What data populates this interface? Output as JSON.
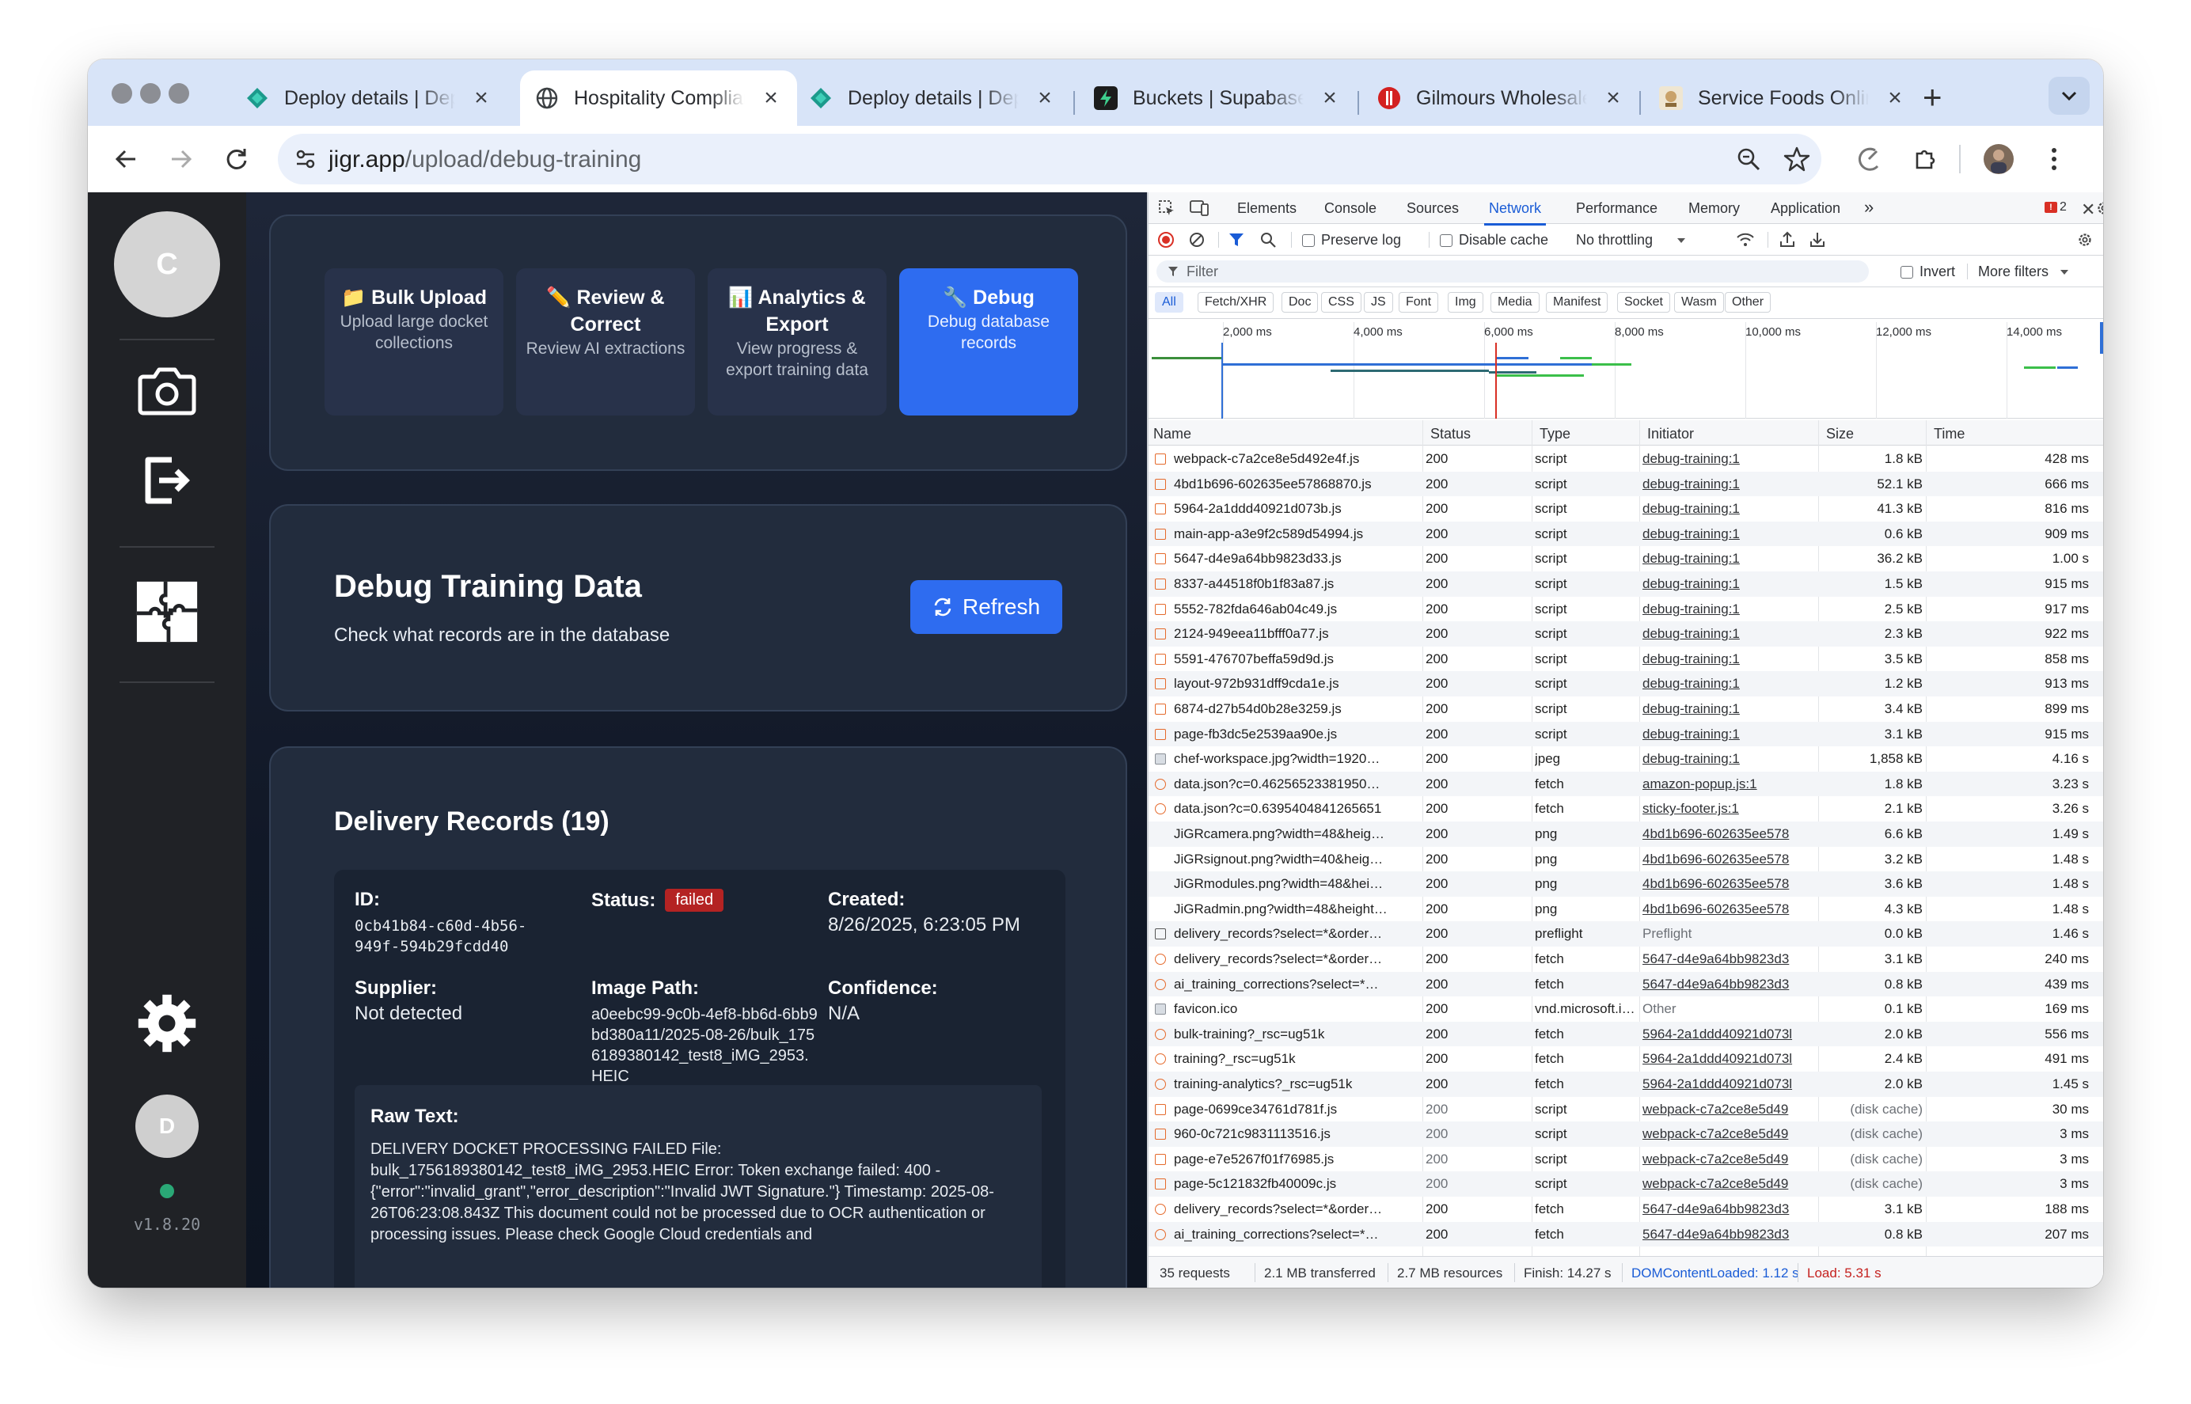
{
  "browser": {
    "tabs": [
      {
        "title": "Deploy details | Deploy",
        "favicon": "netlify-icon"
      },
      {
        "title": "Hospitality Compliance",
        "favicon": "globe-icon"
      },
      {
        "title": "Deploy details | Deploy",
        "favicon": "netlify-icon"
      },
      {
        "title": "Buckets | Supabase",
        "favicon": "supabase-icon"
      },
      {
        "title": "Gilmours Wholesale",
        "favicon": "gilmours-icon"
      },
      {
        "title": "Service Foods Online",
        "favicon": "service-foods-icon"
      }
    ],
    "url_host": "jigr.app",
    "url_path": "/upload/debug-training"
  },
  "app": {
    "sidebar": {
      "avatar_letter": "C",
      "user_letter": "D",
      "version": "v1.8.20"
    },
    "nav_tabs": [
      {
        "emoji": "📁",
        "title": "Bulk Upload",
        "desc": "Upload large docket collections"
      },
      {
        "emoji": "✏️",
        "title": "Review & Correct",
        "desc": "Review AI extractions"
      },
      {
        "emoji": "📊",
        "title": "Analytics & Export",
        "desc": "View progress & export training data"
      },
      {
        "emoji": "🔧",
        "title": "Debug",
        "desc": "Debug database records"
      }
    ],
    "debug": {
      "title": "Debug Training Data",
      "subtitle": "Check what records are in the database",
      "refresh_label": "Refresh"
    },
    "records": {
      "title": "Delivery Records (19)",
      "id_label": "ID:",
      "id_value": "0cb41b84-c60d-4b56-949f-594b29fcdd40",
      "status_label": "Status:",
      "status_value": "failed",
      "created_label": "Created:",
      "created_value": "8/26/2025, 6:23:05 PM",
      "supplier_label": "Supplier:",
      "supplier_value": "Not detected",
      "image_path_label": "Image Path:",
      "image_path_value": "a0eebc99-9c0b-4ef8-bb6d-6bb9bd380a11/2025-08-26/bulk_1756189380142_test8_iMG_2953.HEIC",
      "confidence_label": "Confidence:",
      "confidence_value": "N/A",
      "raw_text_label": "Raw Text:",
      "raw_text_value": "DELIVERY DOCKET PROCESSING FAILED File: bulk_1756189380142_test8_iMG_2953.HEIC Error: Token exchange failed: 400 - {\"error\":\"invalid_grant\",\"error_description\":\"Invalid JWT Signature.\"} Timestamp: 2025-08-26T06:23:08.843Z This document could not be processed due to OCR authentication or processing issues. Please check Google Cloud credentials and"
    }
  },
  "devtools": {
    "tabs": [
      "Elements",
      "Console",
      "Sources",
      "Network",
      "Performance",
      "Memory",
      "Application"
    ],
    "active_tab": "Network",
    "error_count": "2",
    "preserve_log": "Preserve log",
    "disable_cache": "Disable cache",
    "throttling": "No throttling",
    "filter_placeholder": "Filter",
    "invert": "Invert",
    "more_filters": "More filters",
    "type_filters": [
      "All",
      "Fetch/XHR",
      "Doc",
      "CSS",
      "JS",
      "Font",
      "Img",
      "Media",
      "Manifest",
      "Socket",
      "Wasm",
      "Other"
    ],
    "timeline_labels": [
      "2,000 ms",
      "4,000 ms",
      "6,000 ms",
      "8,000 ms",
      "10,000 ms",
      "12,000 ms",
      "14,000 ms"
    ],
    "columns": [
      "Name",
      "Status",
      "Type",
      "Initiator",
      "Size",
      "Time"
    ],
    "rows": [
      {
        "icon": "script",
        "name": "webpack-c7a2ce8e5d492e4f.js",
        "status": "200",
        "type": "script",
        "initiator": "debug-training:1",
        "size": "1.8 kB",
        "time": "428 ms"
      },
      {
        "icon": "script",
        "name": "4bd1b696-602635ee57868870.js",
        "status": "200",
        "type": "script",
        "initiator": "debug-training:1",
        "size": "52.1 kB",
        "time": "666 ms"
      },
      {
        "icon": "script",
        "name": "5964-2a1ddd40921d073b.js",
        "status": "200",
        "type": "script",
        "initiator": "debug-training:1",
        "size": "41.3 kB",
        "time": "816 ms"
      },
      {
        "icon": "script",
        "name": "main-app-a3e9f2c589d54994.js",
        "status": "200",
        "type": "script",
        "initiator": "debug-training:1",
        "size": "0.6 kB",
        "time": "909 ms"
      },
      {
        "icon": "script",
        "name": "5647-d4e9a64bb9823d33.js",
        "status": "200",
        "type": "script",
        "initiator": "debug-training:1",
        "size": "36.2 kB",
        "time": "1.00 s"
      },
      {
        "icon": "script",
        "name": "8337-a44518f0b1f83a87.js",
        "status": "200",
        "type": "script",
        "initiator": "debug-training:1",
        "size": "1.5 kB",
        "time": "915 ms"
      },
      {
        "icon": "script",
        "name": "5552-782fda646ab04c49.js",
        "status": "200",
        "type": "script",
        "initiator": "debug-training:1",
        "size": "2.5 kB",
        "time": "917 ms"
      },
      {
        "icon": "script",
        "name": "2124-949eea11bfff0a77.js",
        "status": "200",
        "type": "script",
        "initiator": "debug-training:1",
        "size": "2.3 kB",
        "time": "922 ms"
      },
      {
        "icon": "script",
        "name": "5591-476707beffa59d9d.js",
        "status": "200",
        "type": "script",
        "initiator": "debug-training:1",
        "size": "3.5 kB",
        "time": "858 ms"
      },
      {
        "icon": "script",
        "name": "layout-972b931dff9cda1e.js",
        "status": "200",
        "type": "script",
        "initiator": "debug-training:1",
        "size": "1.2 kB",
        "time": "913 ms"
      },
      {
        "icon": "script",
        "name": "6874-d27b54d0b28e3259.js",
        "status": "200",
        "type": "script",
        "initiator": "debug-training:1",
        "size": "3.4 kB",
        "time": "899 ms"
      },
      {
        "icon": "script",
        "name": "page-fb3dc5e2539aa90e.js",
        "status": "200",
        "type": "script",
        "initiator": "debug-training:1",
        "size": "3.1 kB",
        "time": "915 ms"
      },
      {
        "icon": "img",
        "name": "chef-workspace.jpg?width=1920…",
        "status": "200",
        "type": "jpeg",
        "initiator": "debug-training:1",
        "size": "1,858 kB",
        "time": "4.16 s"
      },
      {
        "icon": "fetch",
        "name": "data.json?c=0.46256523381950…",
        "status": "200",
        "type": "fetch",
        "initiator": "amazon-popup.js:1",
        "size": "1.8 kB",
        "time": "3.23 s"
      },
      {
        "icon": "fetch",
        "name": "data.json?c=0.6395404841265651",
        "status": "200",
        "type": "fetch",
        "initiator": "sticky-footer.js:1",
        "size": "2.1 kB",
        "time": "3.26 s"
      },
      {
        "icon": "none",
        "name": "JiGRcamera.png?width=48&heig…",
        "status": "200",
        "type": "png",
        "initiator": "4bd1b696-602635ee578",
        "size": "6.6 kB",
        "time": "1.49 s"
      },
      {
        "icon": "none",
        "name": "JiGRsignout.png?width=40&heig…",
        "status": "200",
        "type": "png",
        "initiator": "4bd1b696-602635ee578",
        "size": "3.2 kB",
        "time": "1.48 s"
      },
      {
        "icon": "none",
        "name": "JiGRmodules.png?width=48&hei…",
        "status": "200",
        "type": "png",
        "initiator": "4bd1b696-602635ee578",
        "size": "3.6 kB",
        "time": "1.48 s"
      },
      {
        "icon": "none",
        "name": "JiGRadmin.png?width=48&height…",
        "status": "200",
        "type": "png",
        "initiator": "4bd1b696-602635ee578",
        "size": "4.3 kB",
        "time": "1.48 s"
      },
      {
        "icon": "pre",
        "name": "delivery_records?select=*&order…",
        "status": "200",
        "type": "preflight",
        "initiator": "Preflight",
        "size": "0.0 kB",
        "time": "1.46 s"
      },
      {
        "icon": "fetch",
        "name": "delivery_records?select=*&order…",
        "status": "200",
        "type": "fetch",
        "initiator": "5647-d4e9a64bb9823d3",
        "size": "3.1 kB",
        "time": "240 ms"
      },
      {
        "icon": "fetch",
        "name": "ai_training_corrections?select=*…",
        "status": "200",
        "type": "fetch",
        "initiator": "5647-d4e9a64bb9823d3",
        "size": "0.8 kB",
        "time": "439 ms"
      },
      {
        "icon": "img",
        "name": "favicon.ico",
        "status": "200",
        "type": "vnd.microsoft.icon",
        "initiator": "Other",
        "size": "0.1 kB",
        "time": "169 ms"
      },
      {
        "icon": "fetch",
        "name": "bulk-training?_rsc=ug51k",
        "status": "200",
        "type": "fetch",
        "initiator": "5964-2a1ddd40921d073l",
        "size": "2.0 kB",
        "time": "556 ms"
      },
      {
        "icon": "fetch",
        "name": "training?_rsc=ug51k",
        "status": "200",
        "type": "fetch",
        "initiator": "5964-2a1ddd40921d073l",
        "size": "2.4 kB",
        "time": "491 ms"
      },
      {
        "icon": "fetch",
        "name": "training-analytics?_rsc=ug51k",
        "status": "200",
        "type": "fetch",
        "initiator": "5964-2a1ddd40921d073l",
        "size": "2.0 kB",
        "time": "1.45 s"
      },
      {
        "icon": "script",
        "name": "page-0699ce34761d781f.js",
        "status": "200",
        "type": "script",
        "initiator": "webpack-c7a2ce8e5d49",
        "size": "(disk cache)",
        "time": "30 ms"
      },
      {
        "icon": "script",
        "name": "960-0c721c9831113516.js",
        "status": "200",
        "type": "script",
        "initiator": "webpack-c7a2ce8e5d49",
        "size": "(disk cache)",
        "time": "3 ms"
      },
      {
        "icon": "script",
        "name": "page-e7e5267f01f76985.js",
        "status": "200",
        "type": "script",
        "initiator": "webpack-c7a2ce8e5d49",
        "size": "(disk cache)",
        "time": "3 ms"
      },
      {
        "icon": "script",
        "name": "page-5c121832fb40009c.js",
        "status": "200",
        "type": "script",
        "initiator": "webpack-c7a2ce8e5d49",
        "size": "(disk cache)",
        "time": "3 ms"
      },
      {
        "icon": "fetch",
        "name": "delivery_records?select=*&order…",
        "status": "200",
        "type": "fetch",
        "initiator": "5647-d4e9a64bb9823d3",
        "size": "3.1 kB",
        "time": "188 ms"
      },
      {
        "icon": "fetch",
        "name": "ai_training_corrections?select=*…",
        "status": "200",
        "type": "fetch",
        "initiator": "5647-d4e9a64bb9823d3",
        "size": "0.8 kB",
        "time": "207 ms"
      }
    ],
    "summary": {
      "requests": "35 requests",
      "transferred": "2.1 MB transferred",
      "resources": "2.7 MB resources",
      "finish": "Finish: 14.27 s",
      "dcl": "DOMContentLoaded: 1.12 s",
      "load": "Load: 5.31 s"
    }
  }
}
